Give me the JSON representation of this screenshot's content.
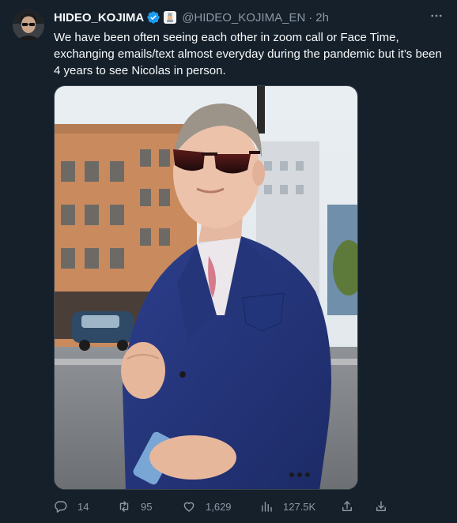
{
  "author": {
    "name": "HIDEO_KOJIMA",
    "handle": "@HIDEO_KOJIMA_EN",
    "separator": "·",
    "time": "2h"
  },
  "tweet": {
    "text": "We have been often seeing each other in zoom call or Face Time, exchanging emails/text almost everyday during the pandemic but it’s been 4 years to see Nicolas in person."
  },
  "actions": {
    "replies": "14",
    "retweets": "95",
    "likes": "1,629",
    "views": "127.5K"
  },
  "colors": {
    "background": "#15202b",
    "text": "#f7f9f9",
    "secondary": "#8b98a5",
    "verified": "#1d9bf0"
  },
  "icons": {
    "verified": "verified-badge-icon",
    "affiliate": "affiliate-badge-icon",
    "more": "more-icon",
    "reply": "reply-icon",
    "retweet": "retweet-icon",
    "like": "like-icon",
    "views": "views-icon",
    "share": "share-icon",
    "download": "download-icon"
  }
}
